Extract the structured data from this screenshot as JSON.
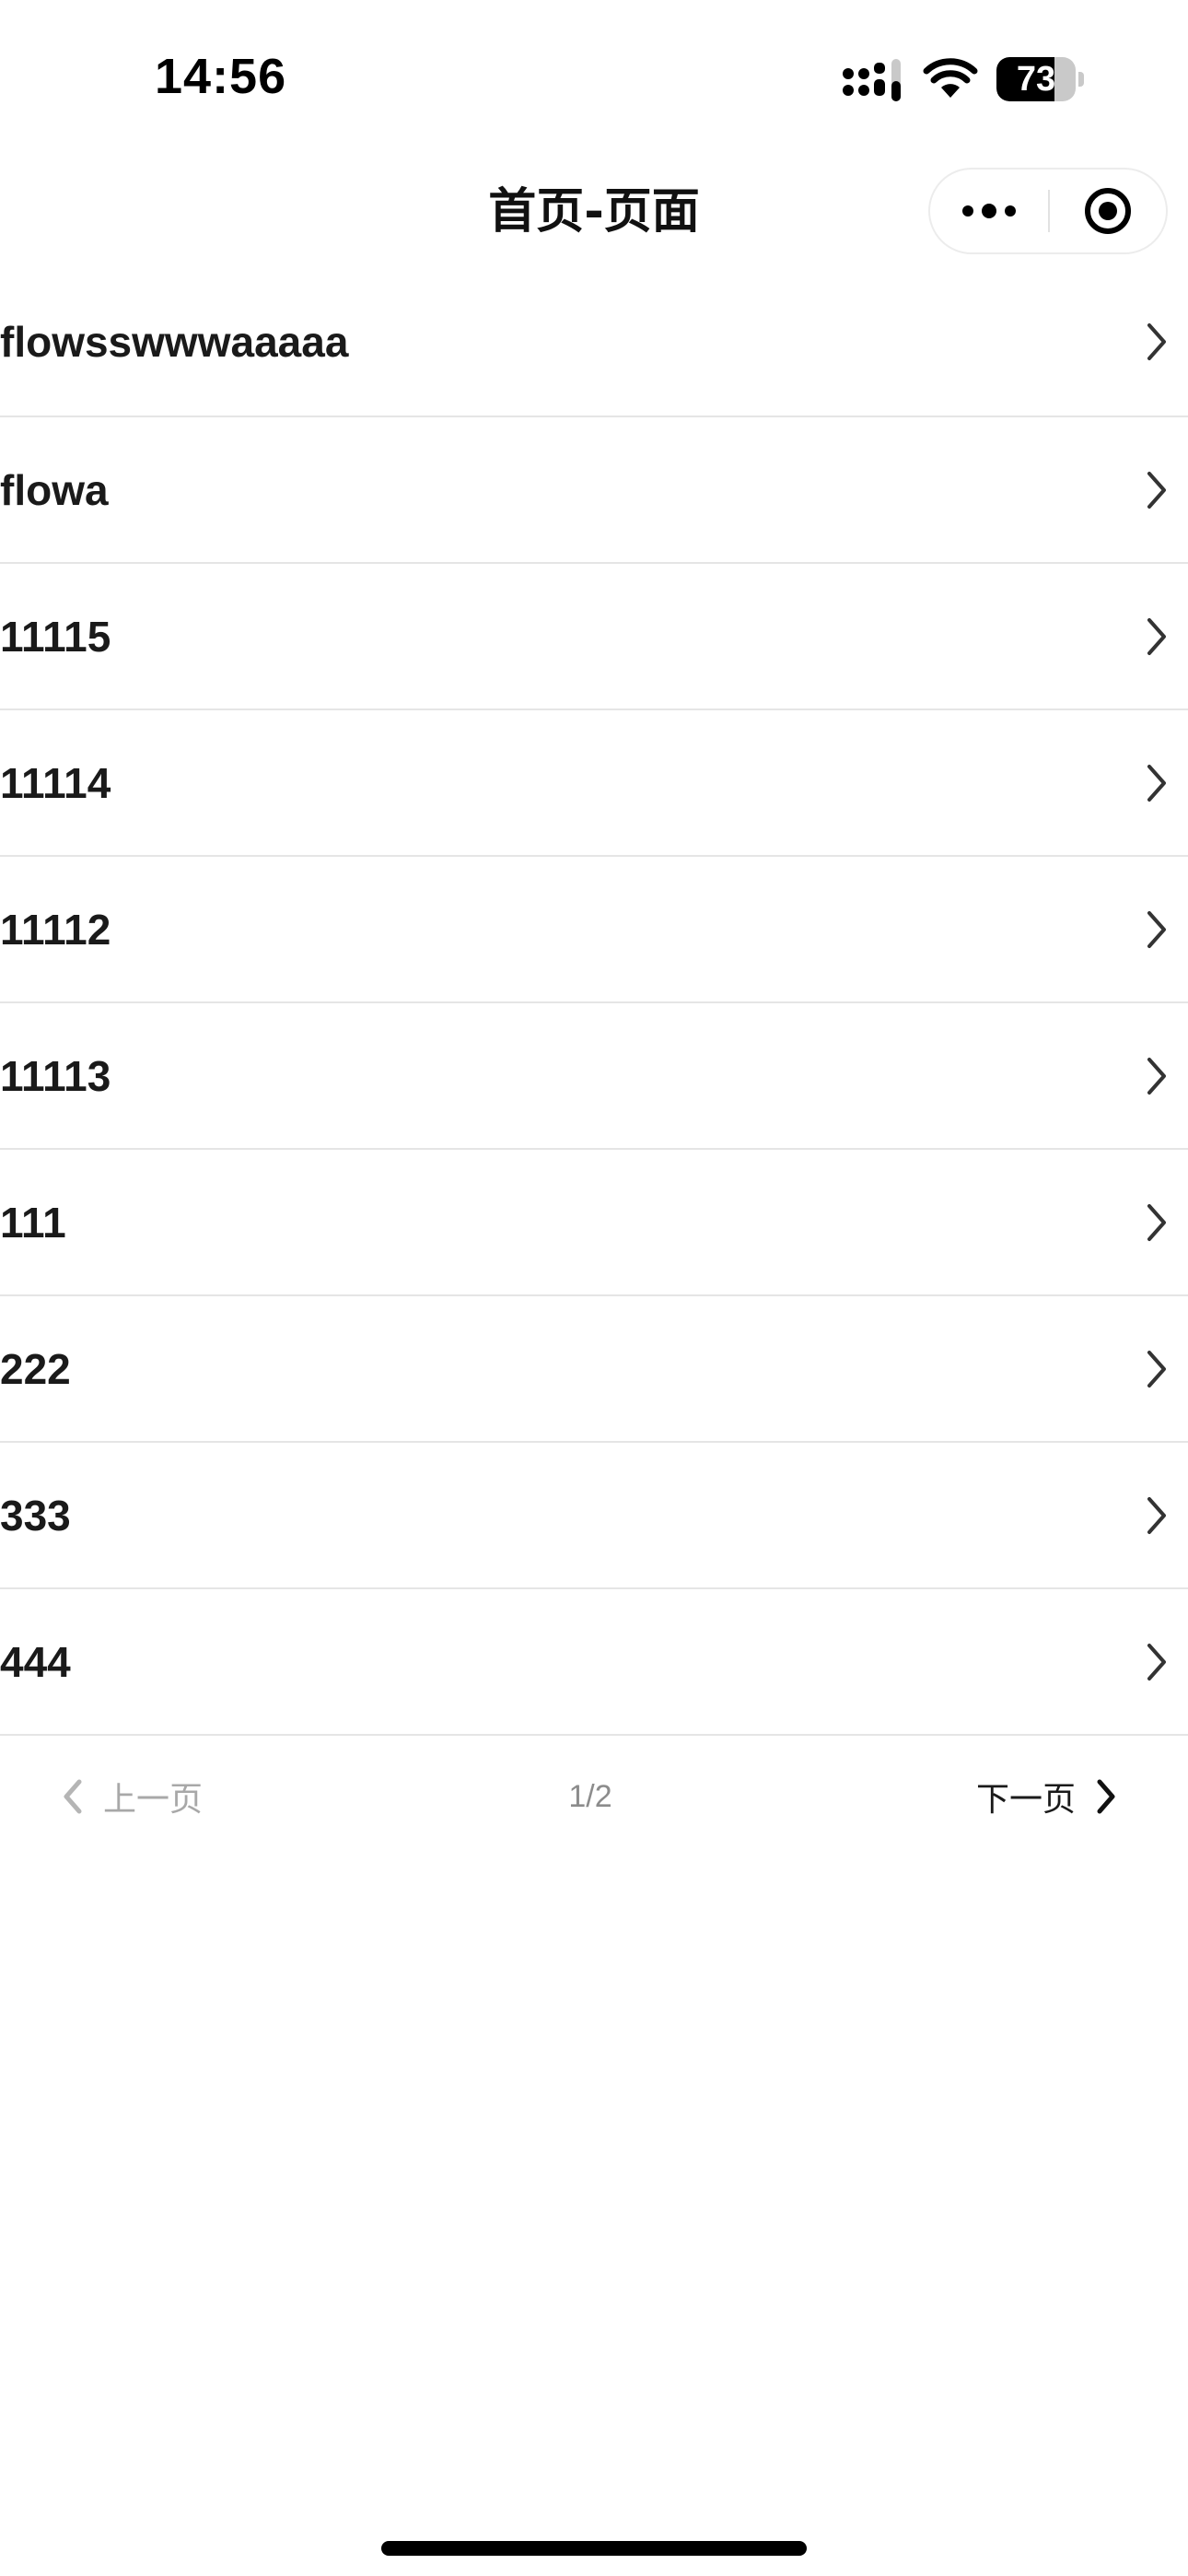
{
  "status_bar": {
    "time": "14:56",
    "battery_level": "73",
    "battery_fraction": 0.73
  },
  "nav": {
    "title": "首页-页面",
    "more_icon": "more-dots-icon",
    "close_icon": "target-circle-icon"
  },
  "list": {
    "items": [
      {
        "label": "flowsswwwaaaaa"
      },
      {
        "label": "flowa"
      },
      {
        "label": "11115"
      },
      {
        "label": "11114"
      },
      {
        "label": "11112"
      },
      {
        "label": "11113"
      },
      {
        "label": "111"
      },
      {
        "label": "222"
      },
      {
        "label": "333"
      },
      {
        "label": "444"
      }
    ]
  },
  "pagination": {
    "prev_label": "上一页",
    "page_indicator": "1/2",
    "next_label": "下一页",
    "prev_color": "#a8a8a8",
    "next_color": "#1a1a1a"
  }
}
